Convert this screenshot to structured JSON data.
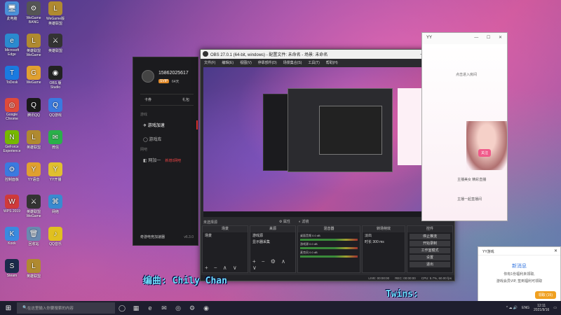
{
  "desktop": {
    "icons": [
      {
        "label": "此电脑",
        "glyph": "🖥",
        "color": "#4a90d9"
      },
      {
        "label": "WeGame BANG",
        "glyph": "⚙",
        "color": "#555"
      },
      {
        "label": "WeGame版 英雄联盟",
        "glyph": "L",
        "color": "#b08a30"
      },
      {
        "label": "Microsoft Edge",
        "glyph": "e",
        "color": "#2a8ad0"
      },
      {
        "label": "英雄联盟 WeGame",
        "glyph": "L",
        "color": "#b08a30"
      },
      {
        "label": "英雄联盟",
        "glyph": "⚔",
        "color": "#333"
      },
      {
        "label": "ToDesk",
        "glyph": "T",
        "color": "#1a7ae0"
      },
      {
        "label": "WeGame",
        "glyph": "G",
        "color": "#e0a030"
      },
      {
        "label": "OBS 版 Studio",
        "glyph": "◉",
        "color": "#222"
      },
      {
        "label": "Google Chrome",
        "glyph": "◎",
        "color": "#e04a3a"
      },
      {
        "label": "腾讯QQ",
        "glyph": "Q",
        "color": "#1a1a1a"
      },
      {
        "label": "QQ游戏",
        "glyph": "Q",
        "color": "#3a7ae0"
      },
      {
        "label": "GeForce Experience",
        "glyph": "N",
        "color": "#76b900"
      },
      {
        "label": "英雄联盟",
        "glyph": "L",
        "color": "#b08a30"
      },
      {
        "label": "微信",
        "glyph": "✉",
        "color": "#2ab04a"
      },
      {
        "label": "控制面板",
        "glyph": "⚙",
        "color": "#3a7ae0"
      },
      {
        "label": "YY语音",
        "glyph": "Y",
        "color": "#e0a030"
      },
      {
        "label": "YY开播",
        "glyph": "Y",
        "color": "#e0c030"
      },
      {
        "label": "WPS 2019",
        "glyph": "W",
        "color": "#d03a3a"
      },
      {
        "label": "英雄联盟 WeGame",
        "glyph": "⚔",
        "color": "#333"
      },
      {
        "label": "网络",
        "glyph": "⌘",
        "color": "#3a8ad0"
      },
      {
        "label": "Kook",
        "glyph": "K",
        "color": "#3a8ae0"
      },
      {
        "label": "回收站",
        "glyph": "🗑",
        "color": "#6a8ab0"
      },
      {
        "label": "QQ音乐",
        "glyph": "♪",
        "color": "#e0c020"
      },
      {
        "label": "Steam",
        "glyph": "S",
        "color": "#1a2a4a"
      },
      {
        "label": "英雄联盟",
        "glyph": "L",
        "color": "#b08a30"
      }
    ]
  },
  "accelerator": {
    "user_id": "15862025617",
    "vip": "SVIP",
    "days": "64天",
    "tab_card": "卡券",
    "tab_gift": "礼包",
    "section_game": "游戏",
    "menu_game_accel": "游戏加速",
    "menu_game_lib": "游戏库",
    "section_network": "网吧",
    "menu_netbar": "网加一",
    "netbar_badge": "新增0网吧",
    "brand": "奇游电竞加速器",
    "version": "v6.3.0"
  },
  "obs": {
    "title": "OBS 27.0.1 (64-bit, windows) - 配置文件: 未命名 - 场景: 未命名",
    "menu": [
      "文件(F)",
      "编辑(E)",
      "视图(V)",
      "停靠部件(D)",
      "场景集合(S)",
      "工具(T)",
      "帮助(H)"
    ],
    "selected_label": "未选择源",
    "properties_btn": "属性",
    "filters_btn": "滤镜",
    "docks": {
      "scenes": {
        "title": "场景",
        "items": [
          "场景"
        ]
      },
      "sources": {
        "title": "来源",
        "items": [
          "游戏源",
          "显示器采集"
        ]
      },
      "mixer": {
        "title": "混音器",
        "channels": [
          {
            "name": "桌面音频",
            "level": "0.0 dB"
          },
          {
            "name": "游戏源",
            "level": "0.0 dB"
          },
          {
            "name": "麦克风",
            "level": "0.0 dB"
          }
        ]
      },
      "transitions": {
        "title": "转场特效",
        "type": "淡出",
        "duration_label": "时长",
        "duration": "300 ms"
      },
      "controls": {
        "title": "控件",
        "buttons": [
          "停止推流",
          "开始录制",
          "工作室模式",
          "设置",
          "退出"
        ]
      }
    },
    "status": {
      "live": "LIVE: 00:00:00",
      "rec": "REC: 00:00:00",
      "cpu": "CPU: 5.7%, 60.00 fps"
    }
  },
  "yy": {
    "title": "YY",
    "link_text": "点击进入房间",
    "chat_line1": "主播美女 精彩直播",
    "chat_line2": "主播一起直播间",
    "follow_btn": "关注"
  },
  "yy_notify": {
    "header": "YY游戏",
    "title": "新消息",
    "line1": "你有1份福利未领取,",
    "line2": "游戏会员VIP, 签到福利可领取",
    "action": "领取 (15)"
  },
  "captions": {
    "composer": "编曲: Chily Chan",
    "twins": "Twins:"
  },
  "taskbar": {
    "start_glyph": "⊞",
    "search_placeholder": "在这里输入你要搜索的内容",
    "apps": [
      "◯",
      "▦",
      "e",
      "✉",
      "◎",
      "⚙",
      "◉"
    ],
    "lang": "ENG",
    "time": "12:11",
    "date": "2021/9/16"
  }
}
